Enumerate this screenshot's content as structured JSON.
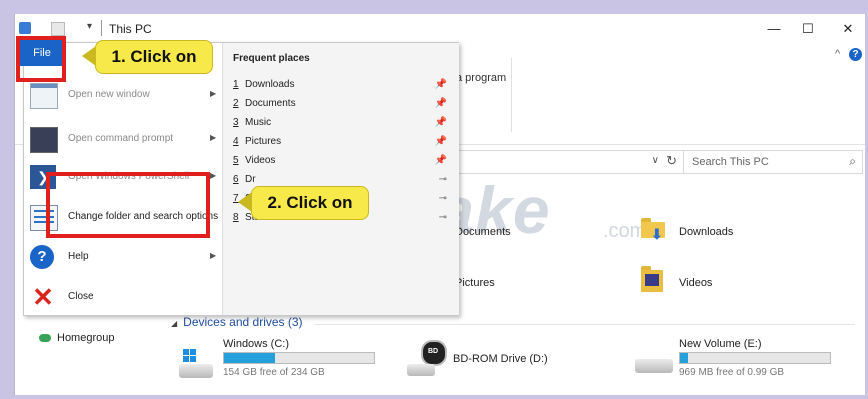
{
  "window": {
    "title": "This PC"
  },
  "window_controls": {
    "minimize": "—",
    "maximize": "☐",
    "close": "✕"
  },
  "ribbon": {
    "collapse_arrow": "^",
    "help": "?",
    "visible_partial_label": "a program"
  },
  "address_bar": {
    "dropdown": "∨",
    "refresh": "↻"
  },
  "search": {
    "placeholder": "Search This PC",
    "icon": "⌕"
  },
  "file_tab": {
    "label": "File"
  },
  "file_menu": {
    "items": [
      {
        "label": "Open new window",
        "icon": "new-window-icon",
        "disabled": true,
        "has_submenu": true
      },
      {
        "label": "Open command prompt",
        "icon": "command-prompt-icon",
        "disabled": true,
        "has_submenu": true
      },
      {
        "label": "Open Windows PowerShell",
        "icon": "powershell-icon",
        "disabled": true,
        "has_submenu": true
      },
      {
        "label": "Change folder and search options",
        "icon": "folder-options-icon",
        "disabled": false,
        "has_submenu": false
      },
      {
        "label": "Help",
        "icon": "help-icon",
        "disabled": false,
        "has_submenu": true
      },
      {
        "label": "Close",
        "icon": "close-icon",
        "disabled": false,
        "has_submenu": false
      }
    ],
    "frequent_places": {
      "title": "Frequent places",
      "items": [
        {
          "num": "1",
          "name": "Downloads",
          "pinned": true
        },
        {
          "num": "2",
          "name": "Documents",
          "pinned": true
        },
        {
          "num": "3",
          "name": "Music",
          "pinned": true
        },
        {
          "num": "4",
          "name": "Pictures",
          "pinned": true
        },
        {
          "num": "5",
          "name": "Videos",
          "pinned": true
        },
        {
          "num": "6",
          "name": "Dr",
          "pinned": false
        },
        {
          "num": "7",
          "name": "Sc",
          "pinned": false
        },
        {
          "num": "8",
          "name": "Start",
          "pinned": false
        }
      ]
    }
  },
  "callouts": {
    "step1": "1. Click on",
    "step2": "2. Click on"
  },
  "watermark": {
    "text": "TipsMake",
    "suffix": ".com"
  },
  "folders": [
    {
      "label": "Documents"
    },
    {
      "label": "Downloads"
    },
    {
      "label": "Pictures"
    },
    {
      "label": "Videos"
    }
  ],
  "nav": {
    "homegroup": "Homegroup"
  },
  "devices": {
    "title": "Devices and drives (3)",
    "drives": [
      {
        "name": "Windows (C:)",
        "free": "154 GB free of 234 GB",
        "used_fraction": 0.34
      },
      {
        "name": "BD-ROM Drive (D:)"
      },
      {
        "name": "New Volume (E:)",
        "free": "969 MB free of 0.99 GB",
        "used_fraction": 0.05
      }
    ]
  }
}
